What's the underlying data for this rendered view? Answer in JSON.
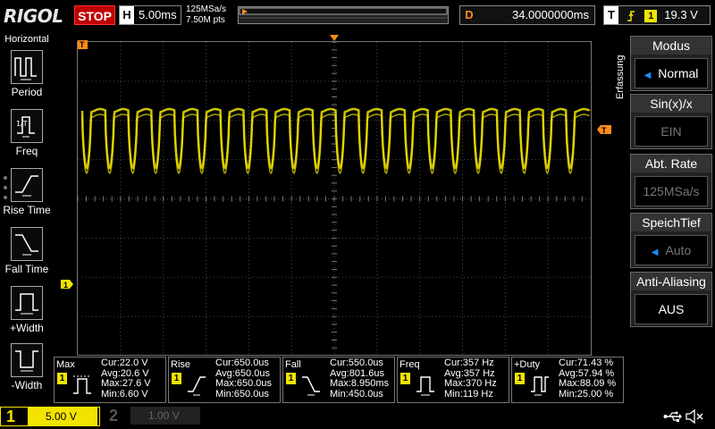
{
  "top": {
    "logo": "RIGOL",
    "run_status": "STOP",
    "timebase_label": "H",
    "timebase_value": "5.00ms",
    "sample_rate": "125MSa/s",
    "memory_points": "7.50M pts",
    "delay_label": "D",
    "delay_value": "34.0000000ms",
    "trigger_label": "T",
    "trigger_source": "1",
    "trigger_level": "19.3 V"
  },
  "left_menu": {
    "title": "Horizontal",
    "items": [
      {
        "label": "Period",
        "icon": "period-icon"
      },
      {
        "label": "Freq",
        "icon": "freq-icon"
      },
      {
        "label": "Rise Time",
        "icon": "rise-time-icon"
      },
      {
        "label": "Fall Time",
        "icon": "fall-time-icon"
      },
      {
        "label": "+Width",
        "icon": "plus-width-icon"
      },
      {
        "label": "-Width",
        "icon": "minus-width-icon"
      }
    ]
  },
  "right_menu": {
    "side_label": "Erfassung",
    "items": [
      {
        "title": "Modus",
        "value": "Normal"
      },
      {
        "title": "Sin(x)/x",
        "value": "EIN"
      },
      {
        "title": "Abt. Rate",
        "value": "125MSa/s"
      },
      {
        "title": "SpeichTief",
        "value": "Auto"
      },
      {
        "title": "Anti-Aliasing",
        "value": "AUS"
      }
    ]
  },
  "measurements": [
    {
      "name": "Max",
      "cur": "Cur:22.0 V",
      "avg": "Avg:20.6 V",
      "max": "Max:27.6 V",
      "min": "Min:6.60 V"
    },
    {
      "name": "Rise",
      "cur": "Cur:650.0us",
      "avg": "Avg:650.0us",
      "max": "Max:650.0us",
      "min": "Min:650.0us"
    },
    {
      "name": "Fall",
      "cur": "Cur:550.0us",
      "avg": "Avg:801.6us",
      "max": "Max:8.950ms",
      "min": "Min:450.0us"
    },
    {
      "name": "Freq",
      "cur": "Cur:357 Hz",
      "avg": "Avg:357 Hz",
      "max": "Max:370 Hz",
      "min": "Min:119 Hz"
    },
    {
      "name": "+Duty",
      "cur": "Cur:71.43 %",
      "avg": "Avg:57.94 %",
      "max": "Max:88.09 %",
      "min": "Min:25.00 %"
    }
  ],
  "meas_badge": "1",
  "channels": {
    "ch1": {
      "number": "1",
      "scale": "5.00 V"
    },
    "ch2": {
      "number": "2",
      "scale": "1.00 V"
    }
  },
  "markers": {
    "ch1_offset": "1",
    "trigger_pos": "T",
    "trigger_level": "T"
  },
  "colors": {
    "ch1": "#f2e400",
    "trigger": "#ff8c1a",
    "stop": "#c00000",
    "grid": "#4a4a4a"
  },
  "waveform": {
    "cycles": 22,
    "period_ms": 2.8
  }
}
